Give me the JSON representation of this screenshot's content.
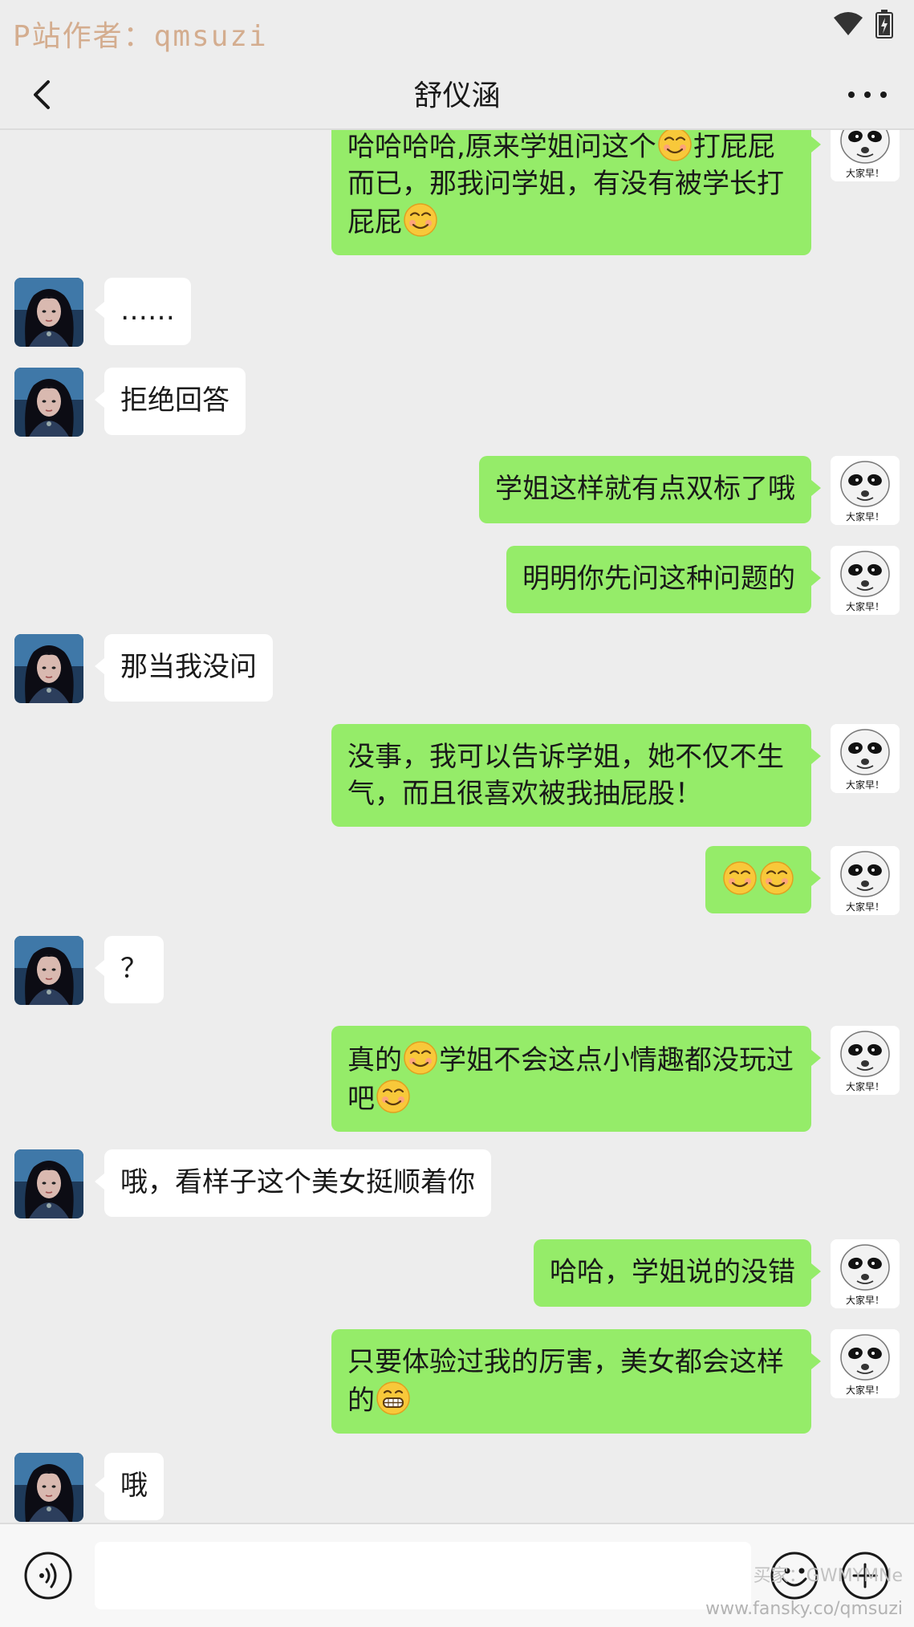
{
  "status_bar": {
    "watermark": "P站作者：qmsuzi"
  },
  "header": {
    "title": "舒仪涵"
  },
  "colors": {
    "self_bubble": "#95ec69",
    "other_bubble": "#ffffff",
    "background": "#ededed"
  },
  "icons": {
    "back": "chevron-left-icon",
    "more": "more-dots-icon",
    "voice": "voice-icon",
    "emoji": "emoji-face-icon",
    "plus": "plus-circle-icon",
    "smiley": "flushed-smile-emoji",
    "grin": "grin-emoji"
  },
  "avatars": {
    "self_caption": "大家早！"
  },
  "messages": [
    {
      "side": "right",
      "text": "哈哈哈哈,原来学姐问这个",
      "emoji_after": "flushed-smile-emoji",
      "text2": "打屁屁而已，那我问学姐，有没有被学长打屁屁",
      "emoji_end": "flushed-smile-emoji"
    },
    {
      "side": "left",
      "text": "……"
    },
    {
      "side": "left",
      "text": "拒绝回答"
    },
    {
      "side": "right",
      "text": "学姐这样就有点双标了哦"
    },
    {
      "side": "right",
      "text": "明明你先问这种问题的"
    },
    {
      "side": "left",
      "text": "那当我没问"
    },
    {
      "side": "right",
      "text": "没事，我可以告诉学姐，她不仅不生气，而且很喜欢被我抽屁股！"
    },
    {
      "side": "right",
      "emoji_only": [
        "flushed-smile-emoji",
        "flushed-smile-emoji"
      ]
    },
    {
      "side": "left",
      "text": "？"
    },
    {
      "side": "right",
      "text": "真的",
      "emoji_after": "flushed-smile-emoji",
      "text2": "学姐不会这点小情趣都没玩过吧",
      "emoji_end": "flushed-smile-emoji"
    },
    {
      "side": "left",
      "text": "哦，看样子这个美女挺顺着你"
    },
    {
      "side": "right",
      "text": "哈哈，学姐说的没错"
    },
    {
      "side": "right",
      "text": "只要体验过我的厉害，美女都会这样的",
      "emoji_end": "grin-emoji"
    },
    {
      "side": "left",
      "text": "哦"
    }
  ],
  "input_bar": {
    "value": "",
    "placeholder": ""
  },
  "footer": {
    "watermark": "买家：GWMYMNe",
    "url": "www.fansky.co/qmsuzi"
  }
}
